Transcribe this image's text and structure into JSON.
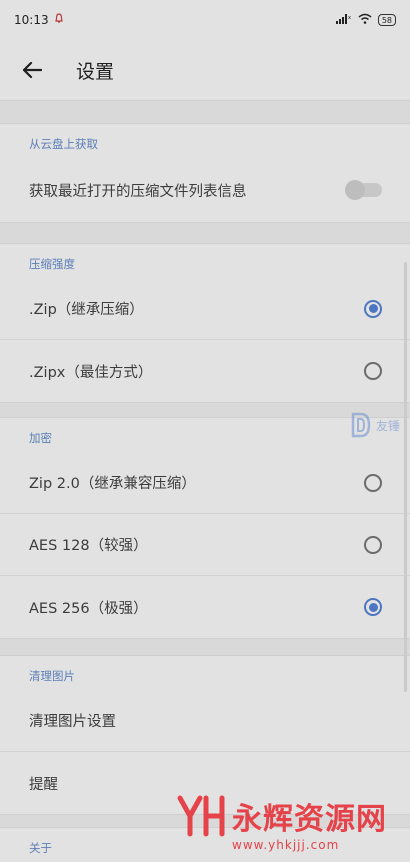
{
  "status": {
    "time": "10:13",
    "battery": "58"
  },
  "header": {
    "title": "设置"
  },
  "sections": {
    "cloud": {
      "header": "从云盘上获取",
      "toggle_label": "获取最近打开的压缩文件列表信息"
    },
    "compression": {
      "header": "压缩强度",
      "options": [
        {
          "label": ".Zip（继承压缩）",
          "selected": true
        },
        {
          "label": ".Zipx（最佳方式）",
          "selected": false
        }
      ]
    },
    "encryption": {
      "header": "加密",
      "options": [
        {
          "label": "Zip 2.0（继承兼容压缩）",
          "selected": false
        },
        {
          "label": "AES 128（较强）",
          "selected": false
        },
        {
          "label": "AES 256（极强）",
          "selected": true
        }
      ]
    },
    "cleanup": {
      "header": "清理图片",
      "items": [
        "清理图片设置",
        "提醒"
      ]
    },
    "about": {
      "header": "关于"
    }
  },
  "watermark": {
    "brand": "永辉资源网",
    "url": "www.yhkjjj.com",
    "small": "友锤"
  },
  "colors": {
    "accent": "#4c76c2",
    "section_header": "#5b7fb8",
    "watermark": "#e5424a"
  }
}
